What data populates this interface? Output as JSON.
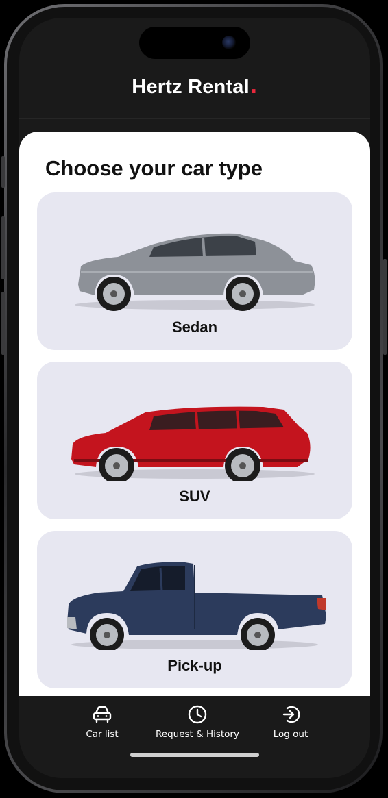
{
  "app": {
    "title": "Hertz Rental",
    "title_dot": ".",
    "accent_color": "#e8283c"
  },
  "main": {
    "heading": "Choose your car type",
    "car_types": [
      {
        "label": "Sedan",
        "body_color": "#8d9198",
        "icon": "sedan-car-image"
      },
      {
        "label": "SUV",
        "body_color": "#c4141e",
        "icon": "suv-car-image"
      },
      {
        "label": "Pick-up",
        "body_color": "#2c3b5c",
        "icon": "pickup-truck-image"
      }
    ]
  },
  "tabbar": {
    "items": [
      {
        "label": "Car list",
        "icon": "car-icon"
      },
      {
        "label": "Request & History",
        "icon": "clock-icon"
      },
      {
        "label": "Log out",
        "icon": "logout-icon"
      }
    ]
  }
}
